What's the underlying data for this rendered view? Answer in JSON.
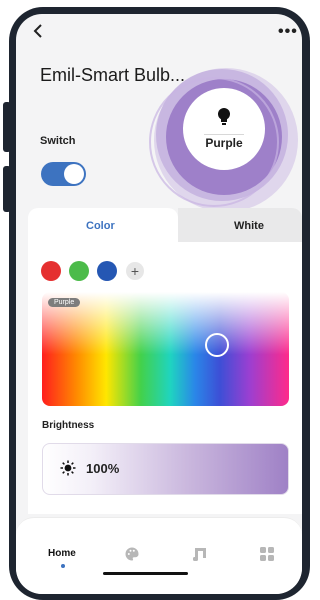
{
  "header": {
    "back_icon": "chevron-left-icon",
    "more_icon": "more-horizontal-icon",
    "more_glyph": "•••",
    "device_name": "Emil-Smart Bulb..."
  },
  "switch": {
    "label": "Switch",
    "state": "on"
  },
  "bulb_preview": {
    "icon": "bulb-icon",
    "color_name": "Purple",
    "color": "#9b82c4"
  },
  "tabs": [
    {
      "label": "Color",
      "active": true
    },
    {
      "label": "White",
      "active": false
    }
  ],
  "swatches": [
    {
      "name": "red",
      "color": "#e53030"
    },
    {
      "name": "green",
      "color": "#4cbb4a"
    },
    {
      "name": "blue",
      "color": "#2557b3"
    }
  ],
  "add_swatch": "+",
  "color_picker": {
    "chip_label": "Purple"
  },
  "brightness": {
    "label": "Brightness",
    "icon": "sun-icon",
    "value": "100%",
    "level": 1.0
  },
  "nav": {
    "home_label": "Home",
    "items": [
      "home",
      "palette-icon",
      "music-icon",
      "grid-icon"
    ]
  },
  "colors": {
    "accent": "#3d73c0",
    "tab_color_text": "#3d73c0",
    "tab_white_text": "#222222"
  }
}
